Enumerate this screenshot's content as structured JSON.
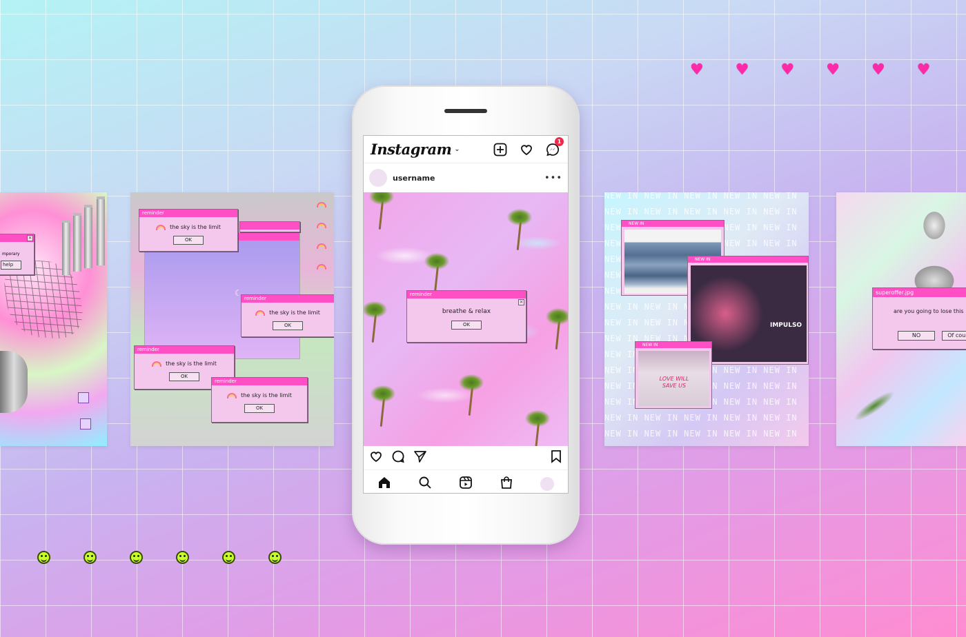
{
  "colors": {
    "accent": "#ff4fc4",
    "heart": "#ff2aa8",
    "smiley": "#c7ff2a"
  },
  "decor": {
    "heart_count": 6,
    "smiley_count": 6
  },
  "card1": {
    "partial_text": "mporary",
    "button": "help"
  },
  "card2": {
    "windows": [
      {
        "title": "reminder",
        "message": "the sky is the limit",
        "ok": "OK"
      },
      {
        "title": "reminder",
        "message": "the sky is the limit",
        "ok": "OK"
      },
      {
        "title": "reminder",
        "message": "the sky is the limit",
        "ok": "OK"
      },
      {
        "title": "reminder",
        "message": "the sky is the limit",
        "ok": "OK"
      }
    ]
  },
  "instagram": {
    "logo": "Instagram",
    "badge_count": "1",
    "username": "username",
    "more": "•••",
    "post": {
      "window_title": "reminder",
      "message": "breathe & relax",
      "ok": "OK"
    }
  },
  "card4": {
    "tile_text": "NEW IN",
    "windows": [
      {
        "title": "NEW IN"
      },
      {
        "title": "NEW IN"
      },
      {
        "title": "NEW IN"
      }
    ],
    "shirt_text": "IMPULSO",
    "tee_text": "LOVE WILL SAVE US"
  },
  "card5": {
    "title": "superoffer.jpg",
    "message": "are you going to lose this",
    "no": "NO",
    "yes": "Of cours"
  }
}
